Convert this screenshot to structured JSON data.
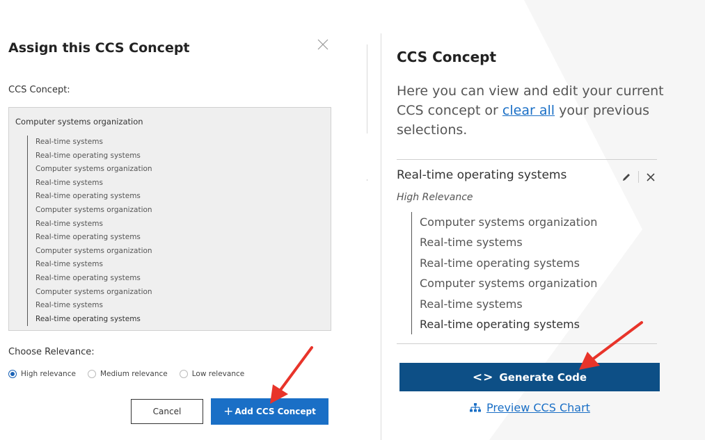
{
  "dialog": {
    "title": "Assign this CCS Concept",
    "concept_label": "CCS Concept:",
    "concept_root": "Computer systems organization",
    "concept_items": [
      "Real-time systems",
      "Real-time operating systems",
      "Computer systems organization",
      "Real-time systems",
      "Real-time operating systems",
      "Computer systems organization",
      "Real-time systems",
      "Real-time operating systems",
      "Computer systems organization",
      "Real-time systems",
      "Real-time operating systems",
      "Computer systems organization",
      "Real-time systems",
      "Real-time operating systems"
    ],
    "relevance_label": "Choose Relevance:",
    "relevance_options": [
      "High relevance",
      "Medium relevance",
      "Low relevance"
    ],
    "relevance_selected": "High relevance",
    "cancel_label": "Cancel",
    "add_label": "Add CCS Concept",
    "add_icon": "plus-icon"
  },
  "panel": {
    "title": "CCS Concept",
    "desc_before": "Here you can view and edit your current CCS concept or ",
    "desc_link": "clear all",
    "desc_after": " your previous selections.",
    "selection": {
      "title": "Real-time operating systems",
      "relevance": "High Relevance",
      "items": [
        "Computer systems organization",
        "Real-time systems",
        "Real-time operating systems",
        "Computer systems organization",
        "Real-time systems",
        "Real-time operating systems"
      ]
    },
    "generate_label": "Generate Code",
    "generate_icon": "code-icon",
    "preview_label": "Preview CCS Chart",
    "preview_icon": "org-chart-icon"
  },
  "colors": {
    "primary": "#1a6fc6",
    "dark_button": "#0d4f86",
    "annotation_arrow": "#e8342a"
  }
}
